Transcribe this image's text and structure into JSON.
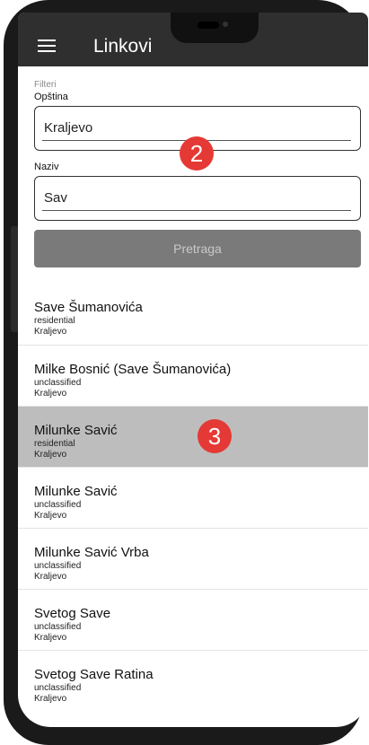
{
  "app": {
    "title": "Linkovi"
  },
  "filters": {
    "section_label": "Filteri",
    "municipality": {
      "label": "Opština",
      "value": "Kraljevo"
    },
    "name": {
      "label": "Naziv",
      "value": "Sav"
    },
    "search_label": "Pretraga"
  },
  "badges": [
    "2",
    "3"
  ],
  "results": [
    {
      "name": "Save Šumanovića",
      "type": "residential",
      "city": "Kraljevo"
    },
    {
      "name": "Milke Bosnić (Save Šumanovića)",
      "type": "unclassified",
      "city": "Kraljevo"
    },
    {
      "name": "Milunke Savić",
      "type": "residential",
      "city": "Kraljevo"
    },
    {
      "name": "Milunke Savić",
      "type": "unclassified",
      "city": "Kraljevo"
    },
    {
      "name": "Milunke Savić Vrba",
      "type": "unclassified",
      "city": "Kraljevo"
    },
    {
      "name": "Svetog Save",
      "type": "unclassified",
      "city": "Kraljevo"
    },
    {
      "name": "Svetog Save Ratina",
      "type": "unclassified",
      "city": "Kraljevo"
    }
  ],
  "colors": {
    "appbar": "#2f2f2f",
    "badge": "#e53935",
    "selected_row": "#bdbdbd",
    "button": "#7a7a7a"
  },
  "icons": {
    "menu": "hamburger-menu-icon"
  }
}
